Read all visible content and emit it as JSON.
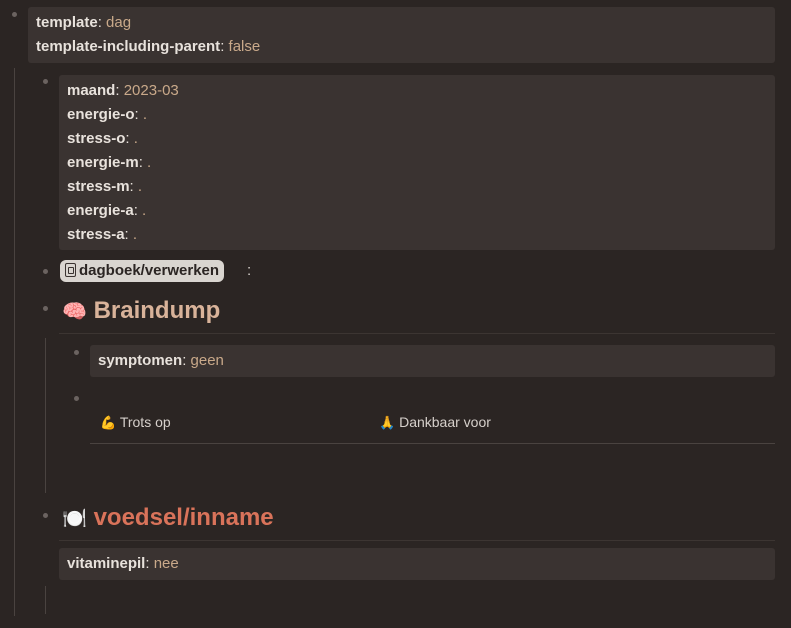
{
  "page_properties": {
    "template_key": "template",
    "template_value": "dag",
    "including_parent_key": "template-including-parent",
    "including_parent_value": "false"
  },
  "day_properties": [
    {
      "key": "maand",
      "value": "2023-03"
    },
    {
      "key": "energie-o",
      "value": "."
    },
    {
      "key": "stress-o",
      "value": "."
    },
    {
      "key": "energie-m",
      "value": "."
    },
    {
      "key": "stress-m",
      "value": "."
    },
    {
      "key": "energie-a",
      "value": "."
    },
    {
      "key": "stress-a",
      "value": "."
    }
  ],
  "page_ref": {
    "label": "dagboek/verwerken",
    "icon": "journal-icon",
    "suffix": ":"
  },
  "braindump": {
    "emoji": "🧠",
    "title": "Braindump",
    "title_color": "#d9b39a",
    "symptomen_key": "symptomen",
    "symptomen_value": "geen",
    "columns": [
      {
        "emoji": "💪",
        "label": "Trots op"
      },
      {
        "emoji": "🙏",
        "label": "Dankbaar voor"
      }
    ]
  },
  "voedsel": {
    "emoji": "🍽️",
    "title": "voedsel/inname",
    "title_color": "#d9735a",
    "vitaminepil_key": "vitaminepil",
    "vitaminepil_value": "nee"
  }
}
